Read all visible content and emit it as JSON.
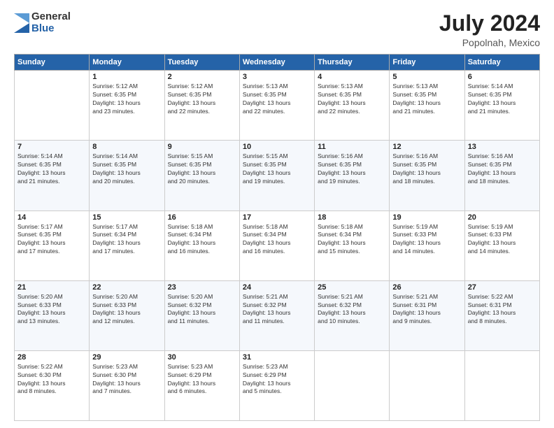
{
  "logo": {
    "general": "General",
    "blue": "Blue"
  },
  "header": {
    "month_year": "July 2024",
    "location": "Popolnah, Mexico"
  },
  "columns": [
    "Sunday",
    "Monday",
    "Tuesday",
    "Wednesday",
    "Thursday",
    "Friday",
    "Saturday"
  ],
  "weeks": [
    [
      {
        "day": "",
        "info": ""
      },
      {
        "day": "1",
        "info": "Sunrise: 5:12 AM\nSunset: 6:35 PM\nDaylight: 13 hours\nand 23 minutes."
      },
      {
        "day": "2",
        "info": "Sunrise: 5:12 AM\nSunset: 6:35 PM\nDaylight: 13 hours\nand 22 minutes."
      },
      {
        "day": "3",
        "info": "Sunrise: 5:13 AM\nSunset: 6:35 PM\nDaylight: 13 hours\nand 22 minutes."
      },
      {
        "day": "4",
        "info": "Sunrise: 5:13 AM\nSunset: 6:35 PM\nDaylight: 13 hours\nand 22 minutes."
      },
      {
        "day": "5",
        "info": "Sunrise: 5:13 AM\nSunset: 6:35 PM\nDaylight: 13 hours\nand 21 minutes."
      },
      {
        "day": "6",
        "info": "Sunrise: 5:14 AM\nSunset: 6:35 PM\nDaylight: 13 hours\nand 21 minutes."
      }
    ],
    [
      {
        "day": "7",
        "info": "Sunrise: 5:14 AM\nSunset: 6:35 PM\nDaylight: 13 hours\nand 21 minutes."
      },
      {
        "day": "8",
        "info": "Sunrise: 5:14 AM\nSunset: 6:35 PM\nDaylight: 13 hours\nand 20 minutes."
      },
      {
        "day": "9",
        "info": "Sunrise: 5:15 AM\nSunset: 6:35 PM\nDaylight: 13 hours\nand 20 minutes."
      },
      {
        "day": "10",
        "info": "Sunrise: 5:15 AM\nSunset: 6:35 PM\nDaylight: 13 hours\nand 19 minutes."
      },
      {
        "day": "11",
        "info": "Sunrise: 5:16 AM\nSunset: 6:35 PM\nDaylight: 13 hours\nand 19 minutes."
      },
      {
        "day": "12",
        "info": "Sunrise: 5:16 AM\nSunset: 6:35 PM\nDaylight: 13 hours\nand 18 minutes."
      },
      {
        "day": "13",
        "info": "Sunrise: 5:16 AM\nSunset: 6:35 PM\nDaylight: 13 hours\nand 18 minutes."
      }
    ],
    [
      {
        "day": "14",
        "info": "Sunrise: 5:17 AM\nSunset: 6:35 PM\nDaylight: 13 hours\nand 17 minutes."
      },
      {
        "day": "15",
        "info": "Sunrise: 5:17 AM\nSunset: 6:34 PM\nDaylight: 13 hours\nand 17 minutes."
      },
      {
        "day": "16",
        "info": "Sunrise: 5:18 AM\nSunset: 6:34 PM\nDaylight: 13 hours\nand 16 minutes."
      },
      {
        "day": "17",
        "info": "Sunrise: 5:18 AM\nSunset: 6:34 PM\nDaylight: 13 hours\nand 16 minutes."
      },
      {
        "day": "18",
        "info": "Sunrise: 5:18 AM\nSunset: 6:34 PM\nDaylight: 13 hours\nand 15 minutes."
      },
      {
        "day": "19",
        "info": "Sunrise: 5:19 AM\nSunset: 6:33 PM\nDaylight: 13 hours\nand 14 minutes."
      },
      {
        "day": "20",
        "info": "Sunrise: 5:19 AM\nSunset: 6:33 PM\nDaylight: 13 hours\nand 14 minutes."
      }
    ],
    [
      {
        "day": "21",
        "info": "Sunrise: 5:20 AM\nSunset: 6:33 PM\nDaylight: 13 hours\nand 13 minutes."
      },
      {
        "day": "22",
        "info": "Sunrise: 5:20 AM\nSunset: 6:33 PM\nDaylight: 13 hours\nand 12 minutes."
      },
      {
        "day": "23",
        "info": "Sunrise: 5:20 AM\nSunset: 6:32 PM\nDaylight: 13 hours\nand 11 minutes."
      },
      {
        "day": "24",
        "info": "Sunrise: 5:21 AM\nSunset: 6:32 PM\nDaylight: 13 hours\nand 11 minutes."
      },
      {
        "day": "25",
        "info": "Sunrise: 5:21 AM\nSunset: 6:32 PM\nDaylight: 13 hours\nand 10 minutes."
      },
      {
        "day": "26",
        "info": "Sunrise: 5:21 AM\nSunset: 6:31 PM\nDaylight: 13 hours\nand 9 minutes."
      },
      {
        "day": "27",
        "info": "Sunrise: 5:22 AM\nSunset: 6:31 PM\nDaylight: 13 hours\nand 8 minutes."
      }
    ],
    [
      {
        "day": "28",
        "info": "Sunrise: 5:22 AM\nSunset: 6:30 PM\nDaylight: 13 hours\nand 8 minutes."
      },
      {
        "day": "29",
        "info": "Sunrise: 5:23 AM\nSunset: 6:30 PM\nDaylight: 13 hours\nand 7 minutes."
      },
      {
        "day": "30",
        "info": "Sunrise: 5:23 AM\nSunset: 6:29 PM\nDaylight: 13 hours\nand 6 minutes."
      },
      {
        "day": "31",
        "info": "Sunrise: 5:23 AM\nSunset: 6:29 PM\nDaylight: 13 hours\nand 5 minutes."
      },
      {
        "day": "",
        "info": ""
      },
      {
        "day": "",
        "info": ""
      },
      {
        "day": "",
        "info": ""
      }
    ]
  ]
}
